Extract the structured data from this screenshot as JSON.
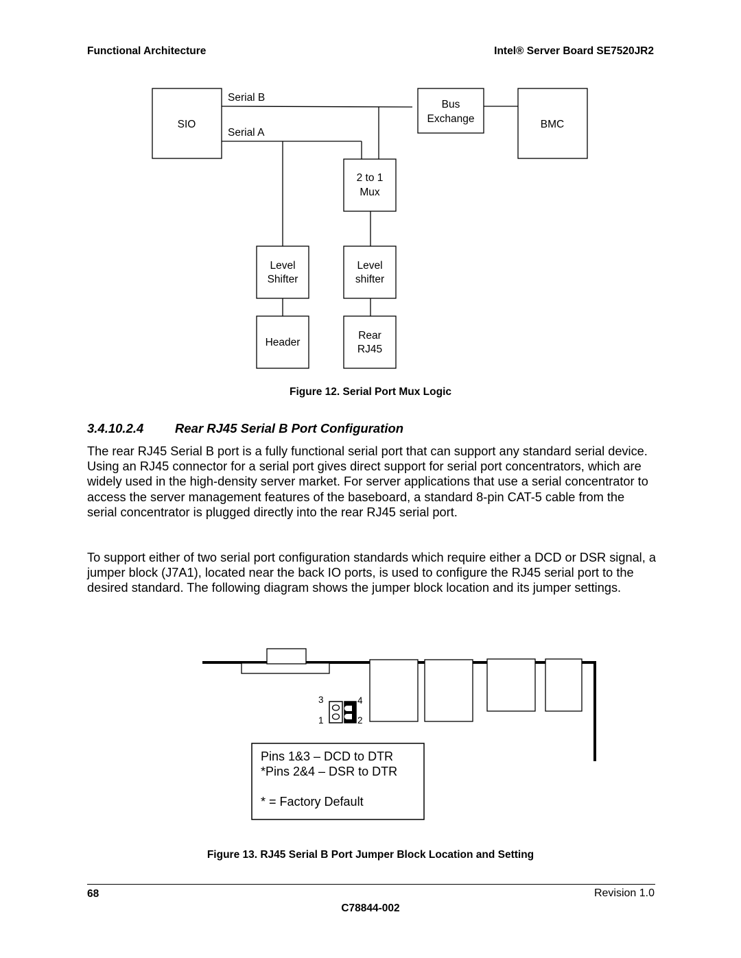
{
  "header": {
    "section": "Functional Architecture",
    "product": "Intel® Server Board SE7520JR2"
  },
  "figure12": {
    "blocks": {
      "sio": "SIO",
      "bus_exchange_line1": "Bus",
      "bus_exchange_line2": "Exchange",
      "bmc": "BMC",
      "mux_line1": "2 to 1",
      "mux_line2": "Mux",
      "level_shifter_left_line1": "Level",
      "level_shifter_left_line2": "Shifter",
      "level_shifter_right_line1": "Level",
      "level_shifter_right_line2": "shifter",
      "header": "Header",
      "rear_rj45_line1": "Rear",
      "rear_rj45_line2": "RJ45"
    },
    "signals": {
      "serial_b": "Serial B",
      "serial_a": "Serial A"
    },
    "caption": "Figure 12. Serial Port Mux Logic"
  },
  "section": {
    "number": "3.4.10.2.4",
    "title": "Rear RJ45 Serial B Port Configuration",
    "paragraphs": [
      "The rear RJ45 Serial B port is a fully functional serial port that can support any standard serial device. Using an RJ45 connector for a serial port gives direct support for serial port concentrators, which are widely used in the high-density server market. For server applications that use a serial concentrator to access the server management features of the baseboard, a standard 8-pin CAT-5 cable from the serial concentrator is plugged directly into the rear RJ45 serial port.",
      "To support either of two serial port configuration standards which require either a DCD or DSR signal, a jumper block (J7A1), located near the back IO ports, is used to configure the RJ45 serial port to the desired standard. The following diagram shows the jumper block location and its jumper settings."
    ]
  },
  "figure13": {
    "pin_labels": {
      "p3": "3",
      "p4": "4",
      "p1": "1",
      "p2": "2"
    },
    "legend": {
      "line1": "Pins 1&3 – DCD to DTR",
      "line2": "*Pins 2&4 – DSR to DTR",
      "line3": "* = Factory Default"
    },
    "caption": "Figure 13. RJ45 Serial B Port Jumper Block Location and Setting"
  },
  "footer": {
    "page_number": "68",
    "revision": "Revision 1.0",
    "doc_number": "C78844-002"
  }
}
